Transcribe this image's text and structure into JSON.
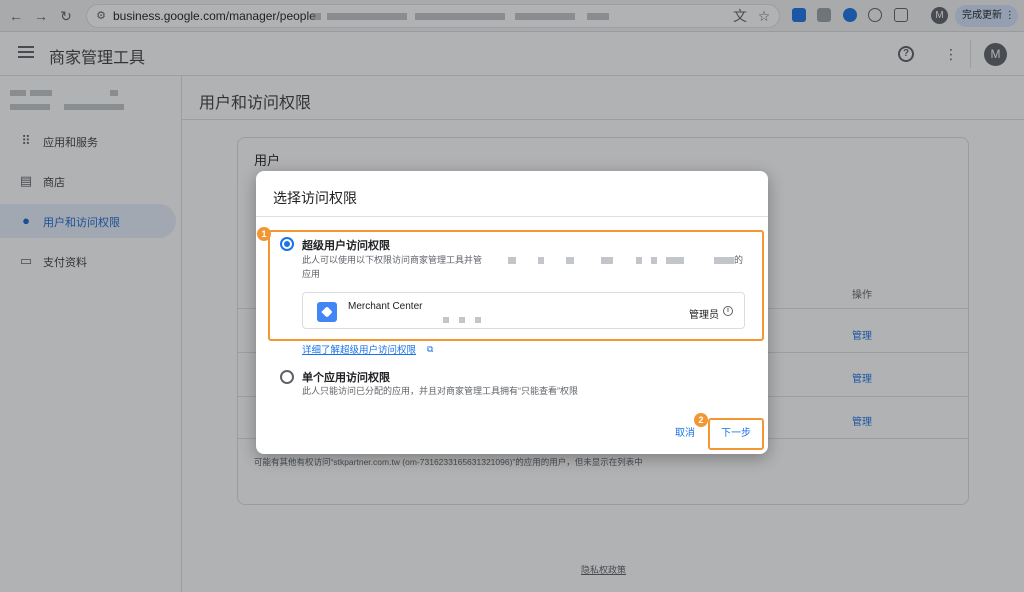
{
  "browser": {
    "url": "business.google.com/manager/people",
    "update_label": "完成更新",
    "profile_initial": "M"
  },
  "app": {
    "title": "商家管理工具",
    "avatar_initial": "M"
  },
  "sidebar": {
    "items": [
      {
        "label": "应用和服务",
        "icon": "apps-grid-icon"
      },
      {
        "label": "商店",
        "icon": "store-icon"
      },
      {
        "label": "用户和访问权限",
        "icon": "person-icon"
      },
      {
        "label": "支付资料",
        "icon": "payment-card-icon"
      }
    ]
  },
  "page": {
    "title": "用户和访问权限",
    "card_title": "用户",
    "column_actions": "操作",
    "manage_label": "管理",
    "footnote": "可能有其他有权访问“stkpartner.com.tw (om-7316233165631321096)”的应用的用户，但未显示在列表中",
    "privacy": "隐私权政策"
  },
  "dialog": {
    "title": "选择访问权限",
    "option1_title": "超级用户访问权限",
    "option1_desc": "此人可以使用以下权限访问商家管理工具并管",
    "option1_desc_end": "的",
    "option1_desc_line2": "应用",
    "app_name": "Merchant Center",
    "role": "管理员",
    "learn_more": "详细了解超级用户访问权限",
    "option2_title": "单个应用访问权限",
    "option2_desc": "此人只能访问已分配的应用，并且对商家管理工具拥有“只能查看”权限",
    "cancel": "取消",
    "next": "下一步"
  },
  "annotations": {
    "badge1": "1",
    "badge2": "2",
    "highlight_color": "#f29734"
  },
  "colors": {
    "accent": "#1a73e8",
    "active_nav_bg": "#e8f0fe"
  }
}
